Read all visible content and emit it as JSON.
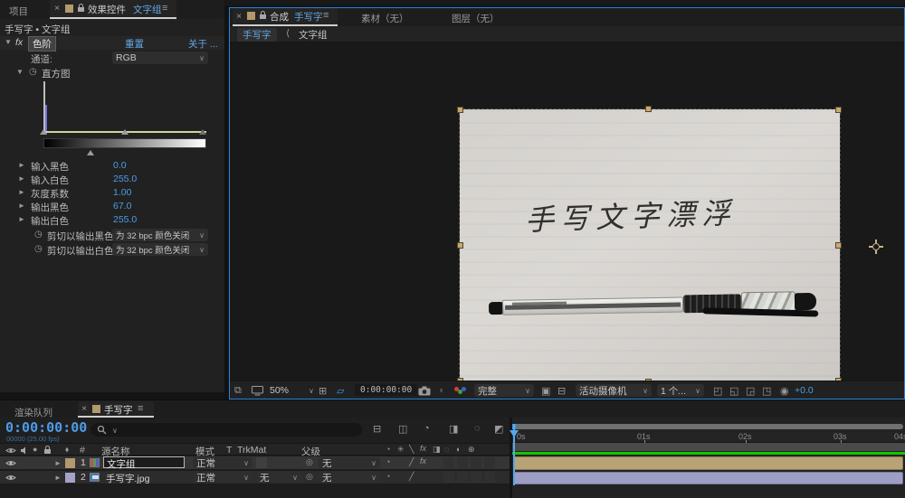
{
  "effect_controls": {
    "tab_project": "项目",
    "tab_effect_controls": "效果控件",
    "tab_comp_name": "文字组",
    "context": "手写字 • 文字组",
    "effect": {
      "fx_badge": "fx",
      "name": "色阶",
      "reset": "重置",
      "about": "关于 ...",
      "channel_label": "通道:",
      "channel_value": "RGB",
      "histogram_label": "直方图",
      "params": [
        {
          "label": "输入黑色",
          "value": "0.0"
        },
        {
          "label": "输入白色",
          "value": "255.0"
        },
        {
          "label": "灰度系数",
          "value": "1.00"
        },
        {
          "label": "输出黑色",
          "value": "67.0"
        },
        {
          "label": "输出白色",
          "value": "255.0"
        }
      ],
      "clip_black_label": "剪切以输出黑色",
      "clip_black_value": "为 32 bpc 颜色关闭",
      "clip_white_label": "剪切以输出白色",
      "clip_white_value": "为 32 bpc 颜色关闭"
    }
  },
  "composition": {
    "tab_label": "合成",
    "tab_comp_name": "手写字",
    "tab_footage": "素材（无）",
    "tab_layer": "图层（无）",
    "breadcrumb_parent": "手写字",
    "breadcrumb_sep": "⟨",
    "breadcrumb_current": "文字组",
    "viewer_text": "手写文字漂浮",
    "toolbar": {
      "zoom": "50%",
      "timecode": "0:00:00:00",
      "resolution": "完整",
      "camera": "活动摄像机",
      "view_count": "1 个...",
      "exposure": "+0.0"
    }
  },
  "timeline": {
    "tab_render_queue": "渲染队列",
    "tab_comp_name": "手写字",
    "timecode": "0:00:00:00",
    "frame_info": "00000 (25.00 fps)",
    "col_hash": "#",
    "col_source_name": "源名称",
    "col_mode": "模式",
    "col_t": "T",
    "col_trkmat": "TrkMat",
    "col_parent": "父级",
    "layers": [
      {
        "index": "1",
        "name": "文字组",
        "mode": "正常",
        "trkmat": "",
        "parent": "无"
      },
      {
        "index": "2",
        "name": "手写字.jpg",
        "mode": "正常",
        "trkmat": "无",
        "parent": "无"
      }
    ],
    "ruler_ticks": [
      "0s",
      "01s",
      "02s",
      "03s",
      "04s"
    ]
  },
  "colors": {
    "accent_blue": "#3f99e8",
    "value_blue": "#4d9ce8",
    "layer1_label": "#b3996b",
    "layer2_label": "#a3a3c8",
    "render_green": "#17c400"
  }
}
